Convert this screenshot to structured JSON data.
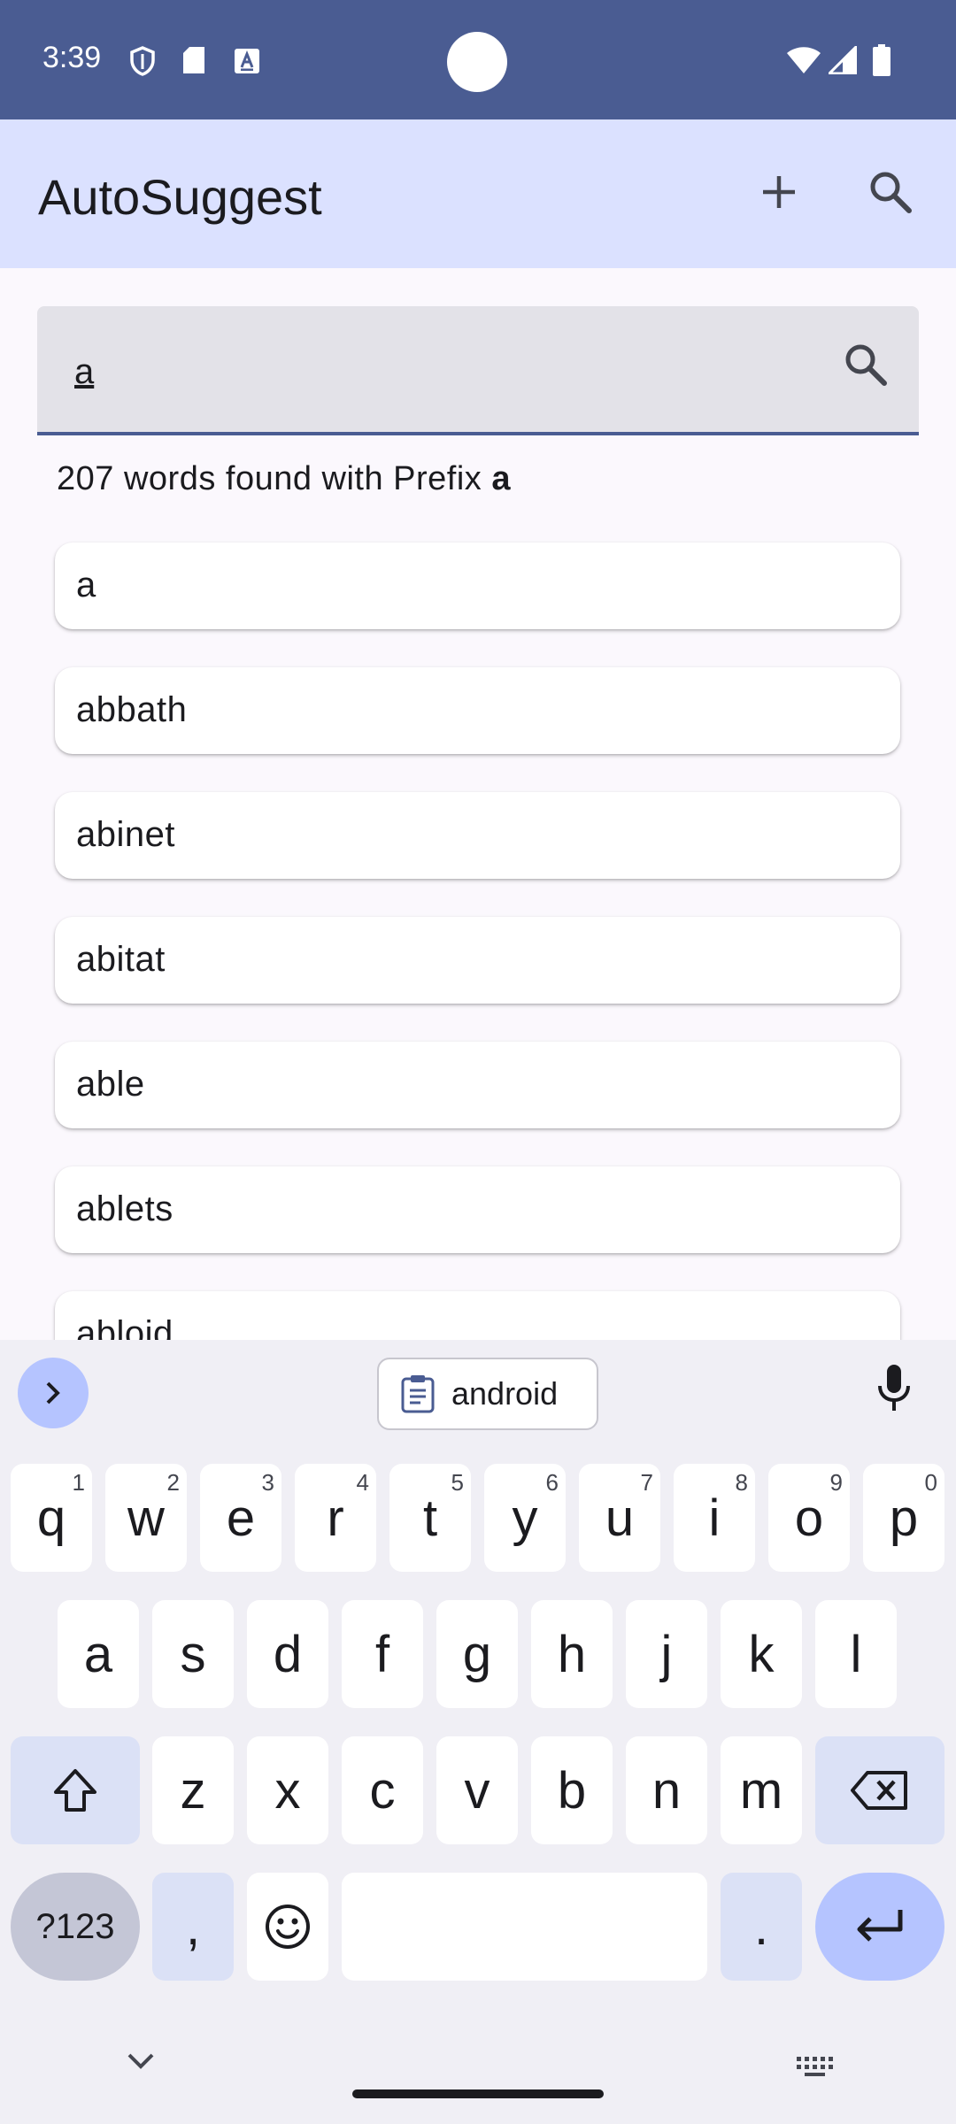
{
  "status_bar": {
    "time": "3:39"
  },
  "app_bar": {
    "title": "AutoSuggest"
  },
  "search": {
    "value": "a"
  },
  "result": {
    "count_text": "207 words found with Prefix ",
    "prefix": "a"
  },
  "words": [
    "a",
    "abbath",
    "abinet",
    "abitat",
    "able",
    "ablets",
    "abloid"
  ],
  "keyboard": {
    "clipboard_suggestion": "android",
    "row1": [
      {
        "letter": "q",
        "num": "1"
      },
      {
        "letter": "w",
        "num": "2"
      },
      {
        "letter": "e",
        "num": "3"
      },
      {
        "letter": "r",
        "num": "4"
      },
      {
        "letter": "t",
        "num": "5"
      },
      {
        "letter": "y",
        "num": "6"
      },
      {
        "letter": "u",
        "num": "7"
      },
      {
        "letter": "i",
        "num": "8"
      },
      {
        "letter": "o",
        "num": "9"
      },
      {
        "letter": "p",
        "num": "0"
      }
    ],
    "row2": [
      "a",
      "s",
      "d",
      "f",
      "g",
      "h",
      "j",
      "k",
      "l"
    ],
    "row3": [
      "z",
      "x",
      "c",
      "v",
      "b",
      "n",
      "m"
    ],
    "symbols_label": "?123",
    "comma": ",",
    "period": "."
  },
  "colors": {
    "status_bar": "#4a5c92",
    "app_bar": "#dbe1ff",
    "accent": "#4a5c92"
  }
}
